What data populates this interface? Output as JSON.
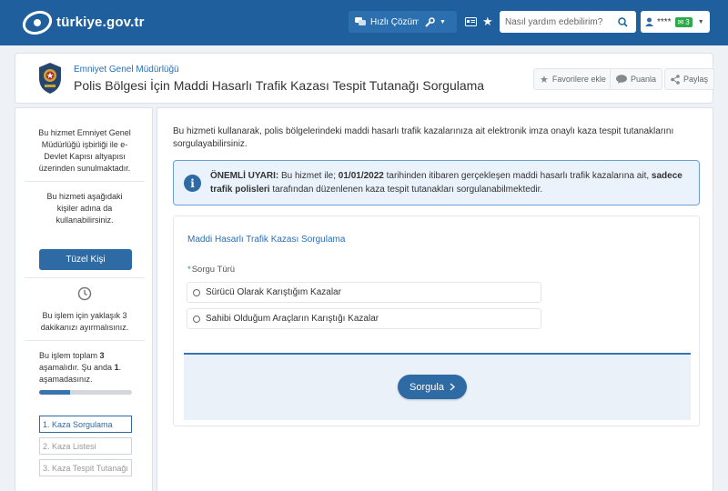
{
  "header": {
    "logo_text": "türkiye.gov.tr",
    "quick_solution_label": "Hızlı Çözüm",
    "search_placeholder": "Nasıl yardım edebilirim?",
    "user_name": "****",
    "user_badge_count": "3"
  },
  "service": {
    "organization": "Emniyet Genel Müdürlüğü",
    "title": "Polis Bölgesi İçin Maddi Hasarlı Trafik Kazası Tespit Tutanağı Sorgulama",
    "actions": [
      "Favorilere ekle",
      "Puanla",
      "Paylaş"
    ]
  },
  "sidebar": {
    "partner_text": "Bu hizmet Emniyet Genel Müdürlüğü işbirliği ile e-Devlet Kapısı altyapısı üzerinden sunulmaktadır.",
    "usable_text": "Bu hizmeti aşağıdaki kişiler adına da kullanabilirsiniz.",
    "tuzel_button": "Tüzel Kişi",
    "time_text": "Bu işlem için yaklaşık 3 dakikanızı ayırmalısınız.",
    "steps_text_1": "Bu işlem toplam ",
    "steps_total": "3",
    "steps_text_2": " aşamalıdır. Şu anda ",
    "steps_current": "1",
    "steps_text_3": ". aşamadasınız.",
    "progress_fraction": 0.33,
    "steps": [
      "1. Kaza Sorgulama",
      "2. Kaza Listesi",
      "3. Kaza Tespit Tutanağı"
    ]
  },
  "main": {
    "intro": "Bu hizmeti kullanarak, polis bölgelerindeki maddi hasarlı trafik kazalarınıza ait elektronik imza onaylı kaza tespit tutanaklarını sorgulayabilirsiniz.",
    "warning": {
      "label": "ÖNEMLİ UYARI:",
      "text_1": " Bu hizmet ile; ",
      "date": "01/01/2022",
      "text_2": " tarihinden itibaren gerçekleşen maddi hasarlı trafik kazalarına ait, ",
      "bold_2": "sadece trafik polisleri",
      "text_3": " tarafından düzenlenen kaza tespit tutanakları sorgulanabilmektedir."
    },
    "form": {
      "title": "Maddi Hasarlı Trafik Kazası Sorgulama",
      "required_mark": "*",
      "field_label": "Sorgu Türü",
      "options": [
        "Sürücü Olarak Karıştığım Kazalar",
        "Sahibi Olduğum Araçların Karıştığı Kazalar"
      ],
      "submit_label": "Sorgula"
    }
  },
  "colors": {
    "topbar": "#1f5f9d",
    "accent": "#2e6aa3",
    "link": "#2a6fb6",
    "badge": "#2eaa4a"
  }
}
